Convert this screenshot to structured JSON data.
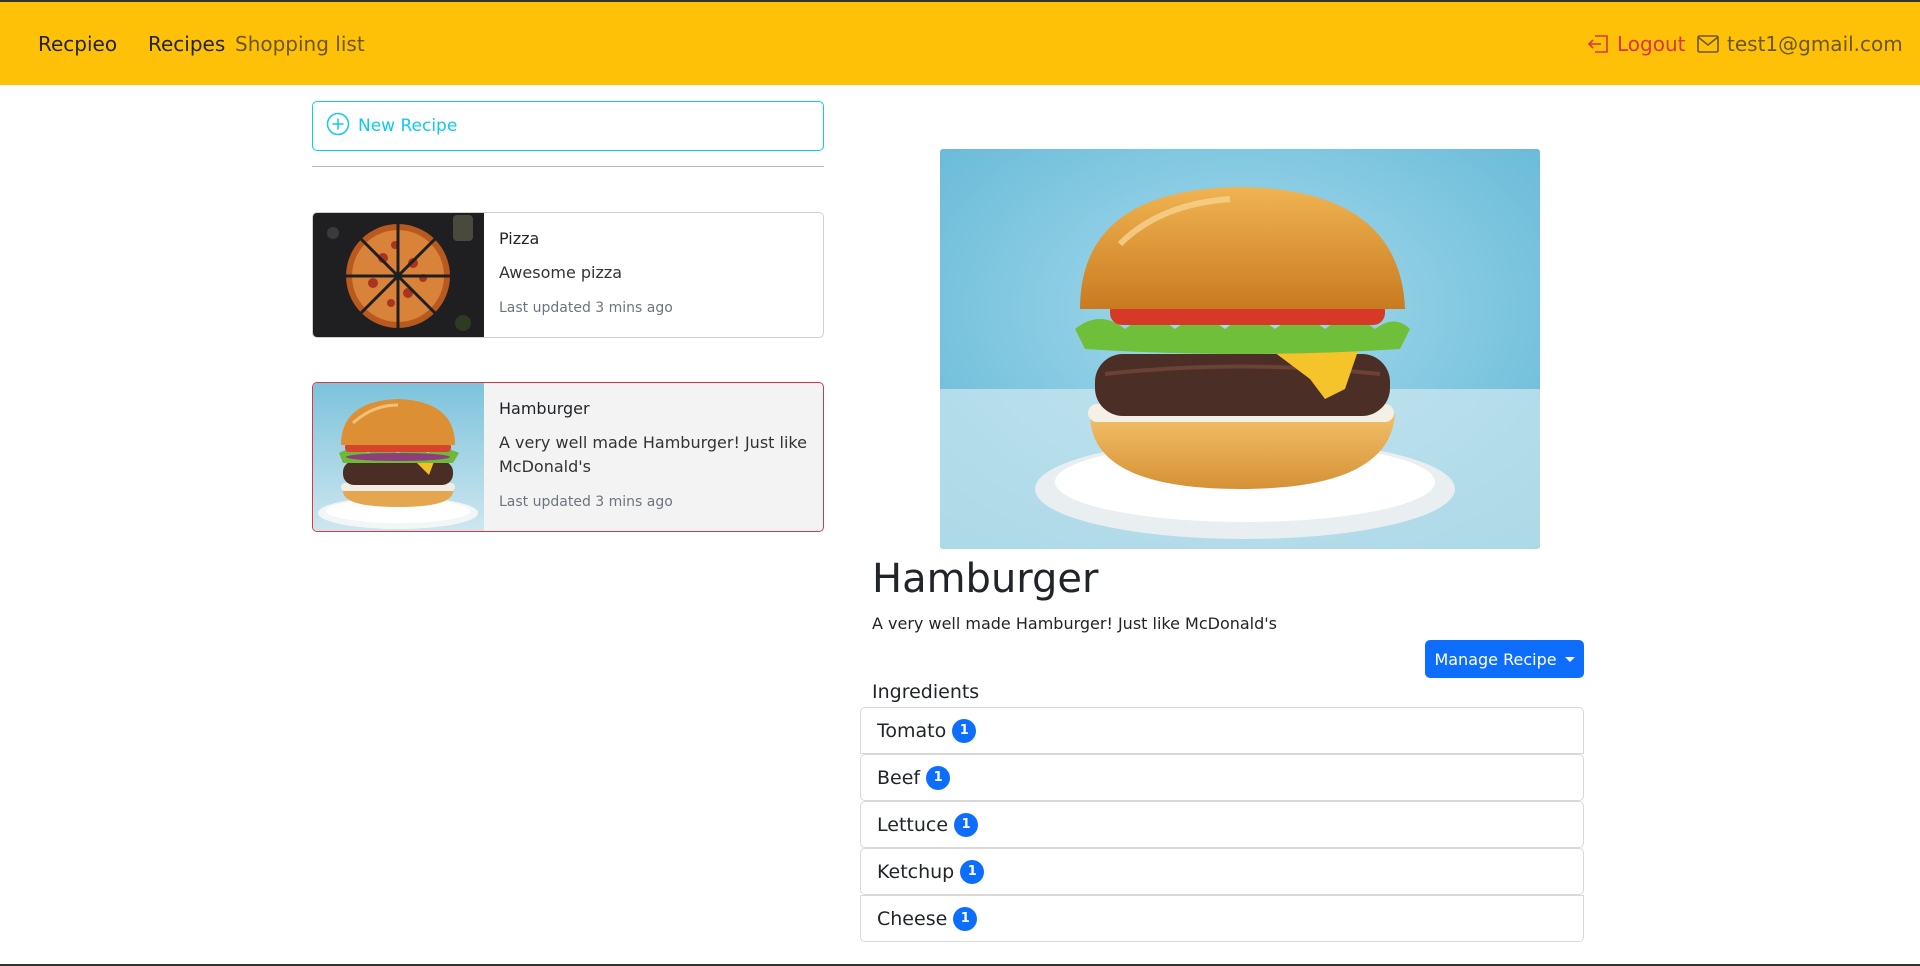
{
  "navbar": {
    "brand": "Recpieo",
    "links": {
      "recipes": "Recipes",
      "shopping": "Shopping list"
    },
    "logout": "Logout",
    "email": "test1@gmail.com",
    "bg_color": "#ffc107"
  },
  "sidebar": {
    "new_recipe": "New Recipe",
    "recipes": [
      {
        "title": "Pizza",
        "description": "Awesome pizza",
        "updated": "Last updated 3 mins ago",
        "active": false
      },
      {
        "title": "Hamburger",
        "description": "A very well made Hamburger! Just like McDonald's",
        "updated": "Last updated 3 mins ago",
        "active": true
      }
    ]
  },
  "detail": {
    "title": "Hamburger",
    "description": "A very well made Hamburger! Just like McDonald's",
    "manage_button": "Manage Recipe",
    "ingredients_heading": "Ingredients",
    "ingredients": [
      {
        "name": "Tomato",
        "amount": "1"
      },
      {
        "name": "Beef",
        "amount": "1"
      },
      {
        "name": "Lettuce",
        "amount": "1"
      },
      {
        "name": "Ketchup",
        "amount": "1"
      },
      {
        "name": "Cheese",
        "amount": "1"
      }
    ]
  },
  "colors": {
    "accent": "#0d6efd",
    "info": "#0dcaf0",
    "danger": "#dc3545"
  }
}
